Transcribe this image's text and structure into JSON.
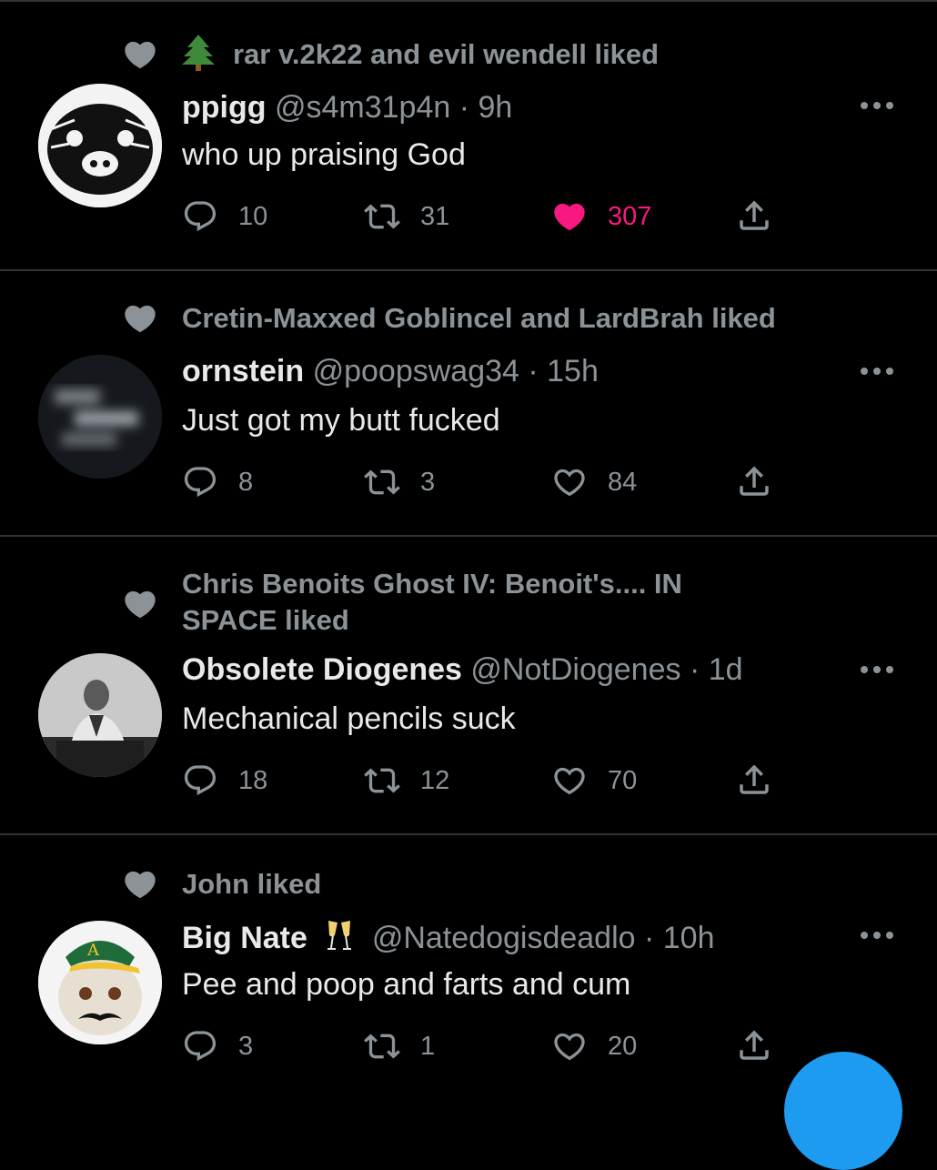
{
  "tweets": [
    {
      "social": "rar v.2k22 and evil wendell liked",
      "social_prefix_icon": "pine-tree-emoji",
      "name": "ppigg",
      "handle": "@s4m31p4n",
      "time": "9h",
      "text": "who up praising God",
      "replies": "10",
      "retweets": "31",
      "likes": "307",
      "liked": true
    },
    {
      "social": "Cretin-Maxxed Goblincel and LardBrah liked",
      "name": "ornstein",
      "handle": "@poopswag34",
      "time": "15h",
      "text": "Just got my butt fucked",
      "replies": "8",
      "retweets": "3",
      "likes": "84",
      "liked": false
    },
    {
      "social_line1": "Chris Benoits Ghost IV: Benoit's.... IN",
      "social_line2": "SPACE liked",
      "name": "Obsolete Diogenes",
      "handle": "@NotDiogenes",
      "time": "1d",
      "text": "Mechanical pencils suck",
      "replies": "18",
      "retweets": "12",
      "likes": "70",
      "liked": false
    },
    {
      "social": "John liked",
      "name": "Big Nate",
      "name_emoji": "clinking-glasses-emoji",
      "handle": "@Natedogisdeadlo",
      "time": "10h",
      "text": "Pee and poop and farts and cum",
      "replies": "3",
      "retweets": "1",
      "likes": "20",
      "liked": false
    }
  ],
  "separator": "·",
  "colors": {
    "background": "#000000",
    "text": "#e7e9ea",
    "secondary": "#8b9398",
    "like": "#f91880",
    "accent": "#1d9bf0",
    "divider": "#2f3336"
  }
}
